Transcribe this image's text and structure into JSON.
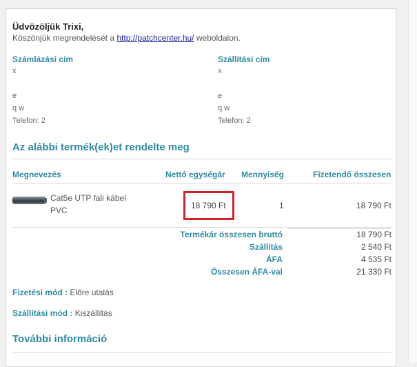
{
  "greeting": "Üdvözöljük Trixi,",
  "thanks": {
    "before": "Köszönjük megrendelését a ",
    "link": "http://patchcenter.hu/",
    "after": " weboldalon."
  },
  "billing": {
    "title": "Számlázási cím",
    "lines": [
      "x",
      "",
      "e",
      "q w",
      "Telefon: 2"
    ]
  },
  "shipping": {
    "title": "Szállítási cím",
    "lines": [
      "x",
      "",
      "e",
      "q w",
      "Telefon: 2"
    ]
  },
  "products_heading": "Az alábbi termék(ek)et rendelte meg",
  "table": {
    "headers": {
      "name": "Megnevezés",
      "unit_price": "Nettó egységár",
      "quantity": "Mennyiség",
      "total": "Fizetendő összesen"
    },
    "rows": [
      {
        "name_line1": "Cat5e UTP fali kábel",
        "name_line2": "PVC",
        "unit_price": "18 790 Ft",
        "quantity": "1",
        "total": "18 790 Ft",
        "image_icon": "cable-icon"
      }
    ]
  },
  "totals": [
    {
      "label": "Termékár összesen bruttó",
      "value": "18 790 Ft"
    },
    {
      "label": "Szállítás",
      "value": "2 540 Ft"
    },
    {
      "label": "ÁFA",
      "value": "4 535 Ft"
    },
    {
      "label": "Összesen ÁFA-val",
      "value": "21 330 Ft"
    }
  ],
  "payment": {
    "label": "Fizetési mód :",
    "value": "Előre utalás"
  },
  "delivery": {
    "label": "Szállítási mód :",
    "value": "Kiszállítás"
  },
  "more_info_heading": "További információ",
  "colors": {
    "accent": "#2e8ba3",
    "highlight": "#d6202b",
    "link": "#1a1aa6"
  }
}
